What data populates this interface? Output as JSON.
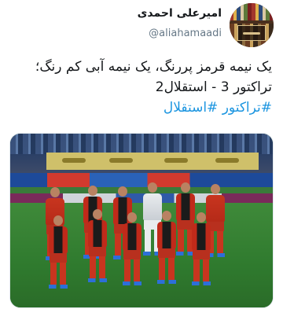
{
  "tweet": {
    "author_name": "امیرعلی احمدی",
    "author_handle": "@aliahamaadi",
    "text_line1": "یک نیمه قرمز پررنگ، یک نیمه آبی کم رنگ؛",
    "text_line2": "تراکتور 3 - استقلال2",
    "hashtags": [
      "#تراکتور",
      "#استقلال"
    ]
  },
  "media": {
    "description_icon": "team-photo"
  },
  "colors": {
    "hashtag": "#1b95e0",
    "text": "#14171a",
    "handle": "#657786"
  }
}
